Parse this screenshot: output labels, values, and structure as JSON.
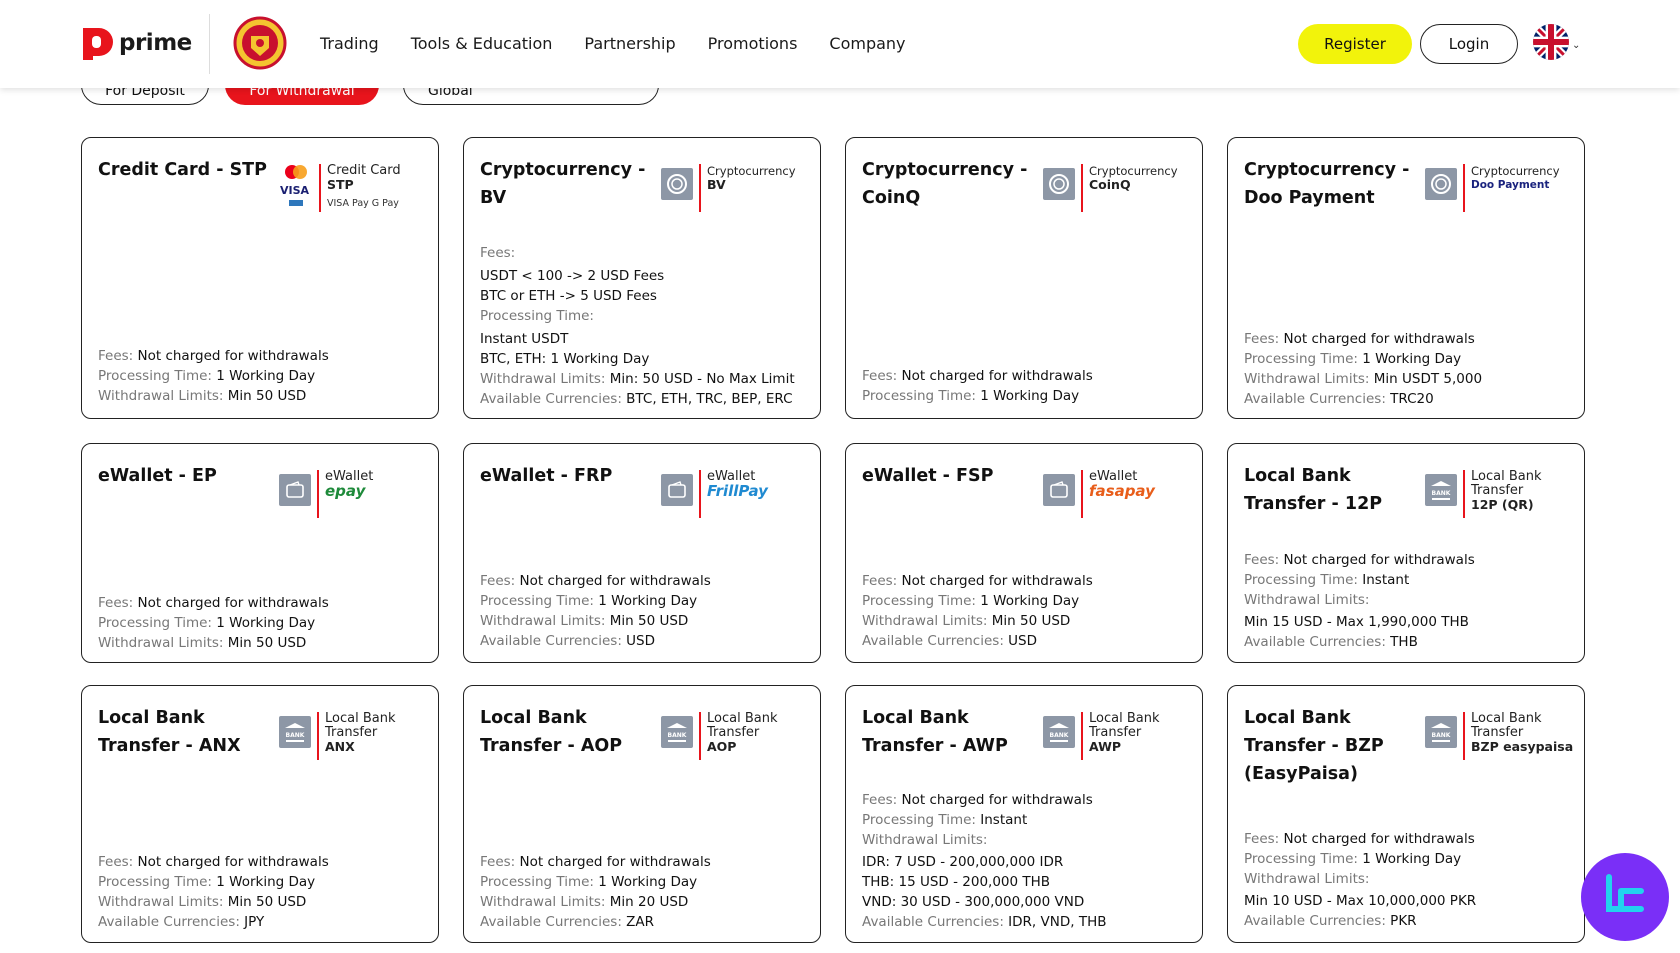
{
  "header": {
    "logo_text": "prime",
    "nav": [
      "Trading",
      "Tools & Education",
      "Partnership",
      "Promotions",
      "Company"
    ],
    "register_label": "Register",
    "login_label": "Login",
    "language_icon": "uk-flag-icon"
  },
  "filters": {
    "deposit_label": "For Deposit",
    "withdrawal_label": "For Withdrawal",
    "region_label": "Global"
  },
  "colors": {
    "accent_red": "#e8141c",
    "register_yellow": "#f2f30b",
    "label_gray": "#777777",
    "chat_purple": "#7a2ff7"
  },
  "cards": [
    {
      "title": "Credit Card - STP",
      "badge_line1": "Credit Card",
      "badge_line2": "STP",
      "badge_extra": "VISA  Pay G Pay",
      "rows": [
        {
          "label": "Fees: ",
          "value": "Not charged for withdrawals"
        },
        {
          "label": "Processing Time: ",
          "value": "1 Working Day"
        },
        {
          "label": "Withdrawal Limits: ",
          "value": "Min 50 USD"
        }
      ]
    },
    {
      "title": "Cryptocurrency - BV",
      "badge_line1": "Cryptocurrency",
      "badge_line2": "BV",
      "rows": [
        {
          "label": "Fees:",
          "value": ""
        },
        {
          "label": "",
          "value": "USDT < 100 -> 2 USD Fees"
        },
        {
          "label": "",
          "value": "BTC or ETH -> 5 USD Fees"
        },
        {
          "label": "Processing Time:",
          "value": ""
        },
        {
          "label": "",
          "value": "Instant USDT"
        },
        {
          "label": "",
          "value": "BTC, ETH: 1 Working Day"
        },
        {
          "label": "Withdrawal Limits: ",
          "value": "Min: 50 USD - No Max Limit"
        },
        {
          "label": "Available Currencies: ",
          "value": "BTC, ETH, TRC, BEP, ERC"
        }
      ]
    },
    {
      "title": "Cryptocurrency - CoinQ",
      "badge_line1": "Cryptocurrency",
      "badge_line2": "CoinQ",
      "rows": [
        {
          "label": "Fees: ",
          "value": "Not charged for withdrawals"
        },
        {
          "label": "Processing Time: ",
          "value": "1 Working Day"
        }
      ]
    },
    {
      "title": "Cryptocurrency - Doo Payment",
      "badge_line1": "Cryptocurrency",
      "badge_line2": "Doo Payment",
      "rows": [
        {
          "label": "Fees: ",
          "value": "Not charged for withdrawals"
        },
        {
          "label": "Processing Time: ",
          "value": "1 Working Day"
        },
        {
          "label": "Withdrawal Limits: ",
          "value": "Min USDT 5,000"
        },
        {
          "label": "Available Currencies: ",
          "value": "TRC20"
        }
      ]
    },
    {
      "title": "eWallet - EP",
      "badge_line1": "eWallet",
      "badge_line2": "epay",
      "rows": [
        {
          "label": "Fees: ",
          "value": "Not charged for withdrawals"
        },
        {
          "label": "Processing Time: ",
          "value": "1 Working Day"
        },
        {
          "label": "Withdrawal Limits: ",
          "value": "Min 50 USD"
        }
      ]
    },
    {
      "title": "eWallet - FRP",
      "badge_line1": "eWallet",
      "badge_line2": "FrillPay",
      "rows": [
        {
          "label": "Fees: ",
          "value": "Not charged for withdrawals"
        },
        {
          "label": "Processing Time: ",
          "value": "1 Working Day"
        },
        {
          "label": "Withdrawal Limits: ",
          "value": "Min 50 USD"
        },
        {
          "label": "Available Currencies: ",
          "value": "USD"
        }
      ]
    },
    {
      "title": "eWallet - FSP",
      "badge_line1": "eWallet",
      "badge_line2": "fasapay",
      "rows": [
        {
          "label": "Fees: ",
          "value": "Not charged for withdrawals"
        },
        {
          "label": "Processing Time: ",
          "value": "1 Working Day"
        },
        {
          "label": "Withdrawal Limits: ",
          "value": "Min 50 USD"
        },
        {
          "label": "Available Currencies: ",
          "value": "USD"
        }
      ]
    },
    {
      "title": "Local Bank Transfer - 12P",
      "badge_line1": "Local Bank",
      "badge_line1b": "Transfer",
      "badge_line2": "12P (QR)",
      "rows": [
        {
          "label": "Fees: ",
          "value": "Not charged for withdrawals"
        },
        {
          "label": "Processing Time: ",
          "value": "Instant"
        },
        {
          "label": "Withdrawal Limits:",
          "value": ""
        },
        {
          "label": "",
          "value": "Min 15 USD - Max 1,990,000 THB"
        },
        {
          "label": "Available Currencies: ",
          "value": "THB"
        }
      ]
    },
    {
      "title": "Local Bank Transfer - ANX",
      "badge_line1": "Local Bank",
      "badge_line1b": "Transfer",
      "badge_line2": "ANX",
      "rows": [
        {
          "label": "Fees: ",
          "value": "Not charged for withdrawals"
        },
        {
          "label": "Processing Time: ",
          "value": "1 Working Day"
        },
        {
          "label": "Withdrawal Limits: ",
          "value": "Min 50 USD"
        },
        {
          "label": "Available Currencies: ",
          "value": "JPY"
        }
      ]
    },
    {
      "title": "Local Bank Transfer - AOP",
      "badge_line1": "Local Bank",
      "badge_line1b": "Transfer",
      "badge_line2": "AOP",
      "rows": [
        {
          "label": "Fees: ",
          "value": "Not charged for withdrawals"
        },
        {
          "label": "Processing Time: ",
          "value": "1 Working Day"
        },
        {
          "label": "Withdrawal Limits: ",
          "value": "Min 20 USD"
        },
        {
          "label": "Available Currencies: ",
          "value": "ZAR"
        }
      ]
    },
    {
      "title": "Local Bank Transfer - AWP",
      "badge_line1": "Local Bank",
      "badge_line1b": "Transfer",
      "badge_line2": "AWP",
      "rows": [
        {
          "label": "Fees: ",
          "value": "Not charged for withdrawals"
        },
        {
          "label": "Processing Time: ",
          "value": "Instant"
        },
        {
          "label": "Withdrawal Limits:",
          "value": ""
        },
        {
          "label": "",
          "value": "IDR: 7 USD - 200,000,000 IDR"
        },
        {
          "label": "",
          "value": "THB: 15 USD - 200,000 THB"
        },
        {
          "label": "",
          "value": "VND: 30 USD - 300,000,000 VND"
        },
        {
          "label": "Available Currencies: ",
          "value": "IDR, VND, THB"
        }
      ]
    },
    {
      "title": "Local Bank Transfer - BZP (EasyPaisa)",
      "badge_line1": "Local Bank",
      "badge_line1b": "Transfer",
      "badge_line2": "BZP easypaisa",
      "rows": [
        {
          "label": "Fees: ",
          "value": "Not charged for withdrawals"
        },
        {
          "label": "Processing Time: ",
          "value": "1 Working Day"
        },
        {
          "label": "Withdrawal Limits:",
          "value": ""
        },
        {
          "label": "",
          "value": "Min 10 USD - Max 10,000,000 PKR"
        },
        {
          "label": "Available Currencies: ",
          "value": "PKR"
        }
      ]
    }
  ]
}
